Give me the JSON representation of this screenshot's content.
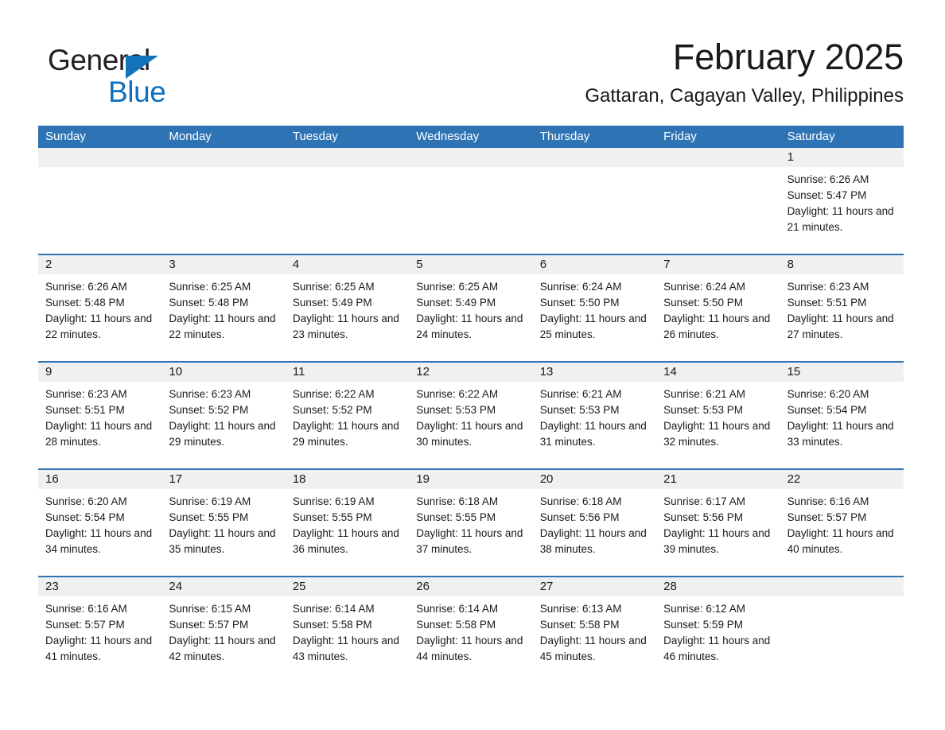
{
  "brand": {
    "logo_text_1": "General",
    "logo_text_2": "Blue",
    "logo_triangle_color": "#1272ba",
    "logo_blue_color": "#0d6fbd"
  },
  "header": {
    "title": "February 2025",
    "subtitle": "Gattaran, Cagayan Valley, Philippines"
  },
  "theme": {
    "accent": "#2e74b5",
    "daynum_bg": "#f0f0f0",
    "text": "#1a1a1a"
  },
  "weekdays": [
    "Sunday",
    "Monday",
    "Tuesday",
    "Wednesday",
    "Thursday",
    "Friday",
    "Saturday"
  ],
  "weeks": [
    [
      {
        "day": ""
      },
      {
        "day": ""
      },
      {
        "day": ""
      },
      {
        "day": ""
      },
      {
        "day": ""
      },
      {
        "day": ""
      },
      {
        "day": "1",
        "sunrise": "Sunrise: 6:26 AM",
        "sunset": "Sunset: 5:47 PM",
        "daylight": "Daylight: 11 hours and 21 minutes."
      }
    ],
    [
      {
        "day": "2",
        "sunrise": "Sunrise: 6:26 AM",
        "sunset": "Sunset: 5:48 PM",
        "daylight": "Daylight: 11 hours and 22 minutes."
      },
      {
        "day": "3",
        "sunrise": "Sunrise: 6:25 AM",
        "sunset": "Sunset: 5:48 PM",
        "daylight": "Daylight: 11 hours and 22 minutes."
      },
      {
        "day": "4",
        "sunrise": "Sunrise: 6:25 AM",
        "sunset": "Sunset: 5:49 PM",
        "daylight": "Daylight: 11 hours and 23 minutes."
      },
      {
        "day": "5",
        "sunrise": "Sunrise: 6:25 AM",
        "sunset": "Sunset: 5:49 PM",
        "daylight": "Daylight: 11 hours and 24 minutes."
      },
      {
        "day": "6",
        "sunrise": "Sunrise: 6:24 AM",
        "sunset": "Sunset: 5:50 PM",
        "daylight": "Daylight: 11 hours and 25 minutes."
      },
      {
        "day": "7",
        "sunrise": "Sunrise: 6:24 AM",
        "sunset": "Sunset: 5:50 PM",
        "daylight": "Daylight: 11 hours and 26 minutes."
      },
      {
        "day": "8",
        "sunrise": "Sunrise: 6:23 AM",
        "sunset": "Sunset: 5:51 PM",
        "daylight": "Daylight: 11 hours and 27 minutes."
      }
    ],
    [
      {
        "day": "9",
        "sunrise": "Sunrise: 6:23 AM",
        "sunset": "Sunset: 5:51 PM",
        "daylight": "Daylight: 11 hours and 28 minutes."
      },
      {
        "day": "10",
        "sunrise": "Sunrise: 6:23 AM",
        "sunset": "Sunset: 5:52 PM",
        "daylight": "Daylight: 11 hours and 29 minutes."
      },
      {
        "day": "11",
        "sunrise": "Sunrise: 6:22 AM",
        "sunset": "Sunset: 5:52 PM",
        "daylight": "Daylight: 11 hours and 29 minutes."
      },
      {
        "day": "12",
        "sunrise": "Sunrise: 6:22 AM",
        "sunset": "Sunset: 5:53 PM",
        "daylight": "Daylight: 11 hours and 30 minutes."
      },
      {
        "day": "13",
        "sunrise": "Sunrise: 6:21 AM",
        "sunset": "Sunset: 5:53 PM",
        "daylight": "Daylight: 11 hours and 31 minutes."
      },
      {
        "day": "14",
        "sunrise": "Sunrise: 6:21 AM",
        "sunset": "Sunset: 5:53 PM",
        "daylight": "Daylight: 11 hours and 32 minutes."
      },
      {
        "day": "15",
        "sunrise": "Sunrise: 6:20 AM",
        "sunset": "Sunset: 5:54 PM",
        "daylight": "Daylight: 11 hours and 33 minutes."
      }
    ],
    [
      {
        "day": "16",
        "sunrise": "Sunrise: 6:20 AM",
        "sunset": "Sunset: 5:54 PM",
        "daylight": "Daylight: 11 hours and 34 minutes."
      },
      {
        "day": "17",
        "sunrise": "Sunrise: 6:19 AM",
        "sunset": "Sunset: 5:55 PM",
        "daylight": "Daylight: 11 hours and 35 minutes."
      },
      {
        "day": "18",
        "sunrise": "Sunrise: 6:19 AM",
        "sunset": "Sunset: 5:55 PM",
        "daylight": "Daylight: 11 hours and 36 minutes."
      },
      {
        "day": "19",
        "sunrise": "Sunrise: 6:18 AM",
        "sunset": "Sunset: 5:55 PM",
        "daylight": "Daylight: 11 hours and 37 minutes."
      },
      {
        "day": "20",
        "sunrise": "Sunrise: 6:18 AM",
        "sunset": "Sunset: 5:56 PM",
        "daylight": "Daylight: 11 hours and 38 minutes."
      },
      {
        "day": "21",
        "sunrise": "Sunrise: 6:17 AM",
        "sunset": "Sunset: 5:56 PM",
        "daylight": "Daylight: 11 hours and 39 minutes."
      },
      {
        "day": "22",
        "sunrise": "Sunrise: 6:16 AM",
        "sunset": "Sunset: 5:57 PM",
        "daylight": "Daylight: 11 hours and 40 minutes."
      }
    ],
    [
      {
        "day": "23",
        "sunrise": "Sunrise: 6:16 AM",
        "sunset": "Sunset: 5:57 PM",
        "daylight": "Daylight: 11 hours and 41 minutes."
      },
      {
        "day": "24",
        "sunrise": "Sunrise: 6:15 AM",
        "sunset": "Sunset: 5:57 PM",
        "daylight": "Daylight: 11 hours and 42 minutes."
      },
      {
        "day": "25",
        "sunrise": "Sunrise: 6:14 AM",
        "sunset": "Sunset: 5:58 PM",
        "daylight": "Daylight: 11 hours and 43 minutes."
      },
      {
        "day": "26",
        "sunrise": "Sunrise: 6:14 AM",
        "sunset": "Sunset: 5:58 PM",
        "daylight": "Daylight: 11 hours and 44 minutes."
      },
      {
        "day": "27",
        "sunrise": "Sunrise: 6:13 AM",
        "sunset": "Sunset: 5:58 PM",
        "daylight": "Daylight: 11 hours and 45 minutes."
      },
      {
        "day": "28",
        "sunrise": "Sunrise: 6:12 AM",
        "sunset": "Sunset: 5:59 PM",
        "daylight": "Daylight: 11 hours and 46 minutes."
      },
      {
        "day": ""
      }
    ]
  ]
}
